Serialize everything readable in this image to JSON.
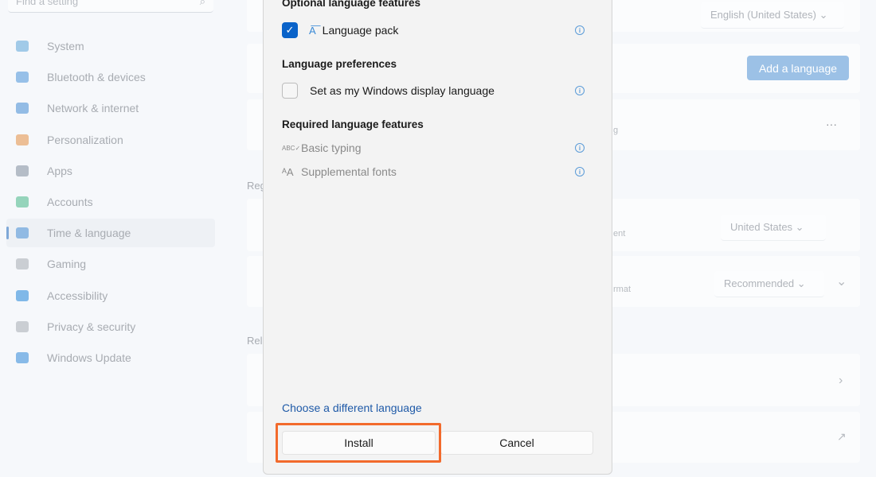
{
  "sidebar": {
    "search_placeholder": "Find a setting",
    "items": [
      {
        "label": "System",
        "icon": "monitor-icon",
        "color": "#7eb6e0"
      },
      {
        "label": "Bluetooth & devices",
        "icon": "bluetooth-icon",
        "color": "#6fa8e0"
      },
      {
        "label": "Network & internet",
        "icon": "wifi-icon",
        "color": "#6aa3dc"
      },
      {
        "label": "Personalization",
        "icon": "brush-icon",
        "color": "#e8a56a"
      },
      {
        "label": "Apps",
        "icon": "apps-icon",
        "color": "#9aa4b0"
      },
      {
        "label": "Accounts",
        "icon": "person-icon",
        "color": "#6cc4a0"
      },
      {
        "label": "Time & language",
        "icon": "globe-clock-icon",
        "color": "#6aa3dc",
        "selected": true
      },
      {
        "label": "Gaming",
        "icon": "gamepad-icon",
        "color": "#b8bcc2"
      },
      {
        "label": "Accessibility",
        "icon": "accessibility-icon",
        "color": "#4f9de0"
      },
      {
        "label": "Privacy & security",
        "icon": "shield-icon",
        "color": "#b8bcc2"
      },
      {
        "label": "Windows Update",
        "icon": "update-icon",
        "color": "#5aa0e0"
      }
    ]
  },
  "main": {
    "display_language": "English (United States)",
    "add_language_label": "Add a language",
    "more_label": "···",
    "region_heading_partial": "Reg",
    "related_heading_partial": "Rel",
    "country": "United States",
    "country_sub_partial": "ent",
    "regional_format": "Recommended",
    "regional_format_sub_partial": "rmat",
    "language_sub_partial": "g"
  },
  "dialog": {
    "optional_heading": "Optional language features",
    "language_pack": {
      "label": "Language pack",
      "checked": true
    },
    "preferences_heading": "Language preferences",
    "display_language": {
      "label": "Set as my Windows display language",
      "checked": false
    },
    "required_heading": "Required language features",
    "required": [
      {
        "label": "Basic typing",
        "icon": "abc-check-icon"
      },
      {
        "label": "Supplemental fonts",
        "icon": "font-size-icon"
      }
    ],
    "choose_link": "Choose a different language",
    "install_label": "Install",
    "cancel_label": "Cancel",
    "accent": "#0a63c9",
    "highlight_color": "#f26a2c"
  }
}
